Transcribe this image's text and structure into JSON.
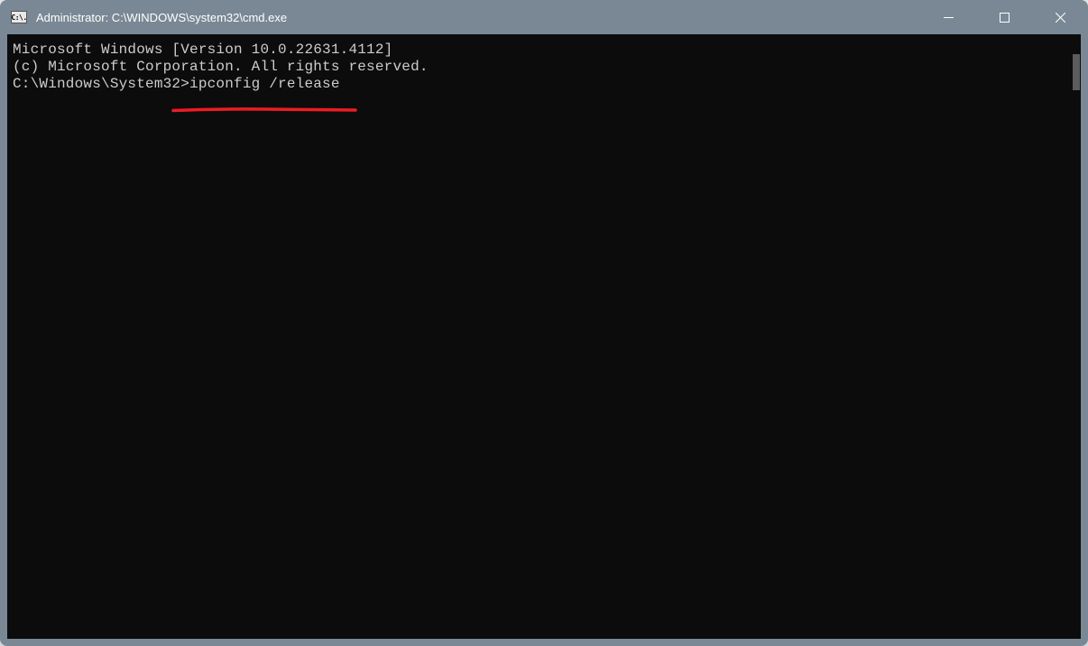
{
  "window": {
    "title": "Administrator: C:\\WINDOWS\\system32\\cmd.exe",
    "app_icon_text": "C:\\."
  },
  "terminal": {
    "line1": "Microsoft Windows [Version 10.0.22631.4112]",
    "line2": "(c) Microsoft Corporation. All rights reserved.",
    "blank": "",
    "prompt": "C:\\Windows\\System32>",
    "command": "ipconfig /release"
  },
  "annotation": {
    "underline_color": "#ed1c24"
  }
}
